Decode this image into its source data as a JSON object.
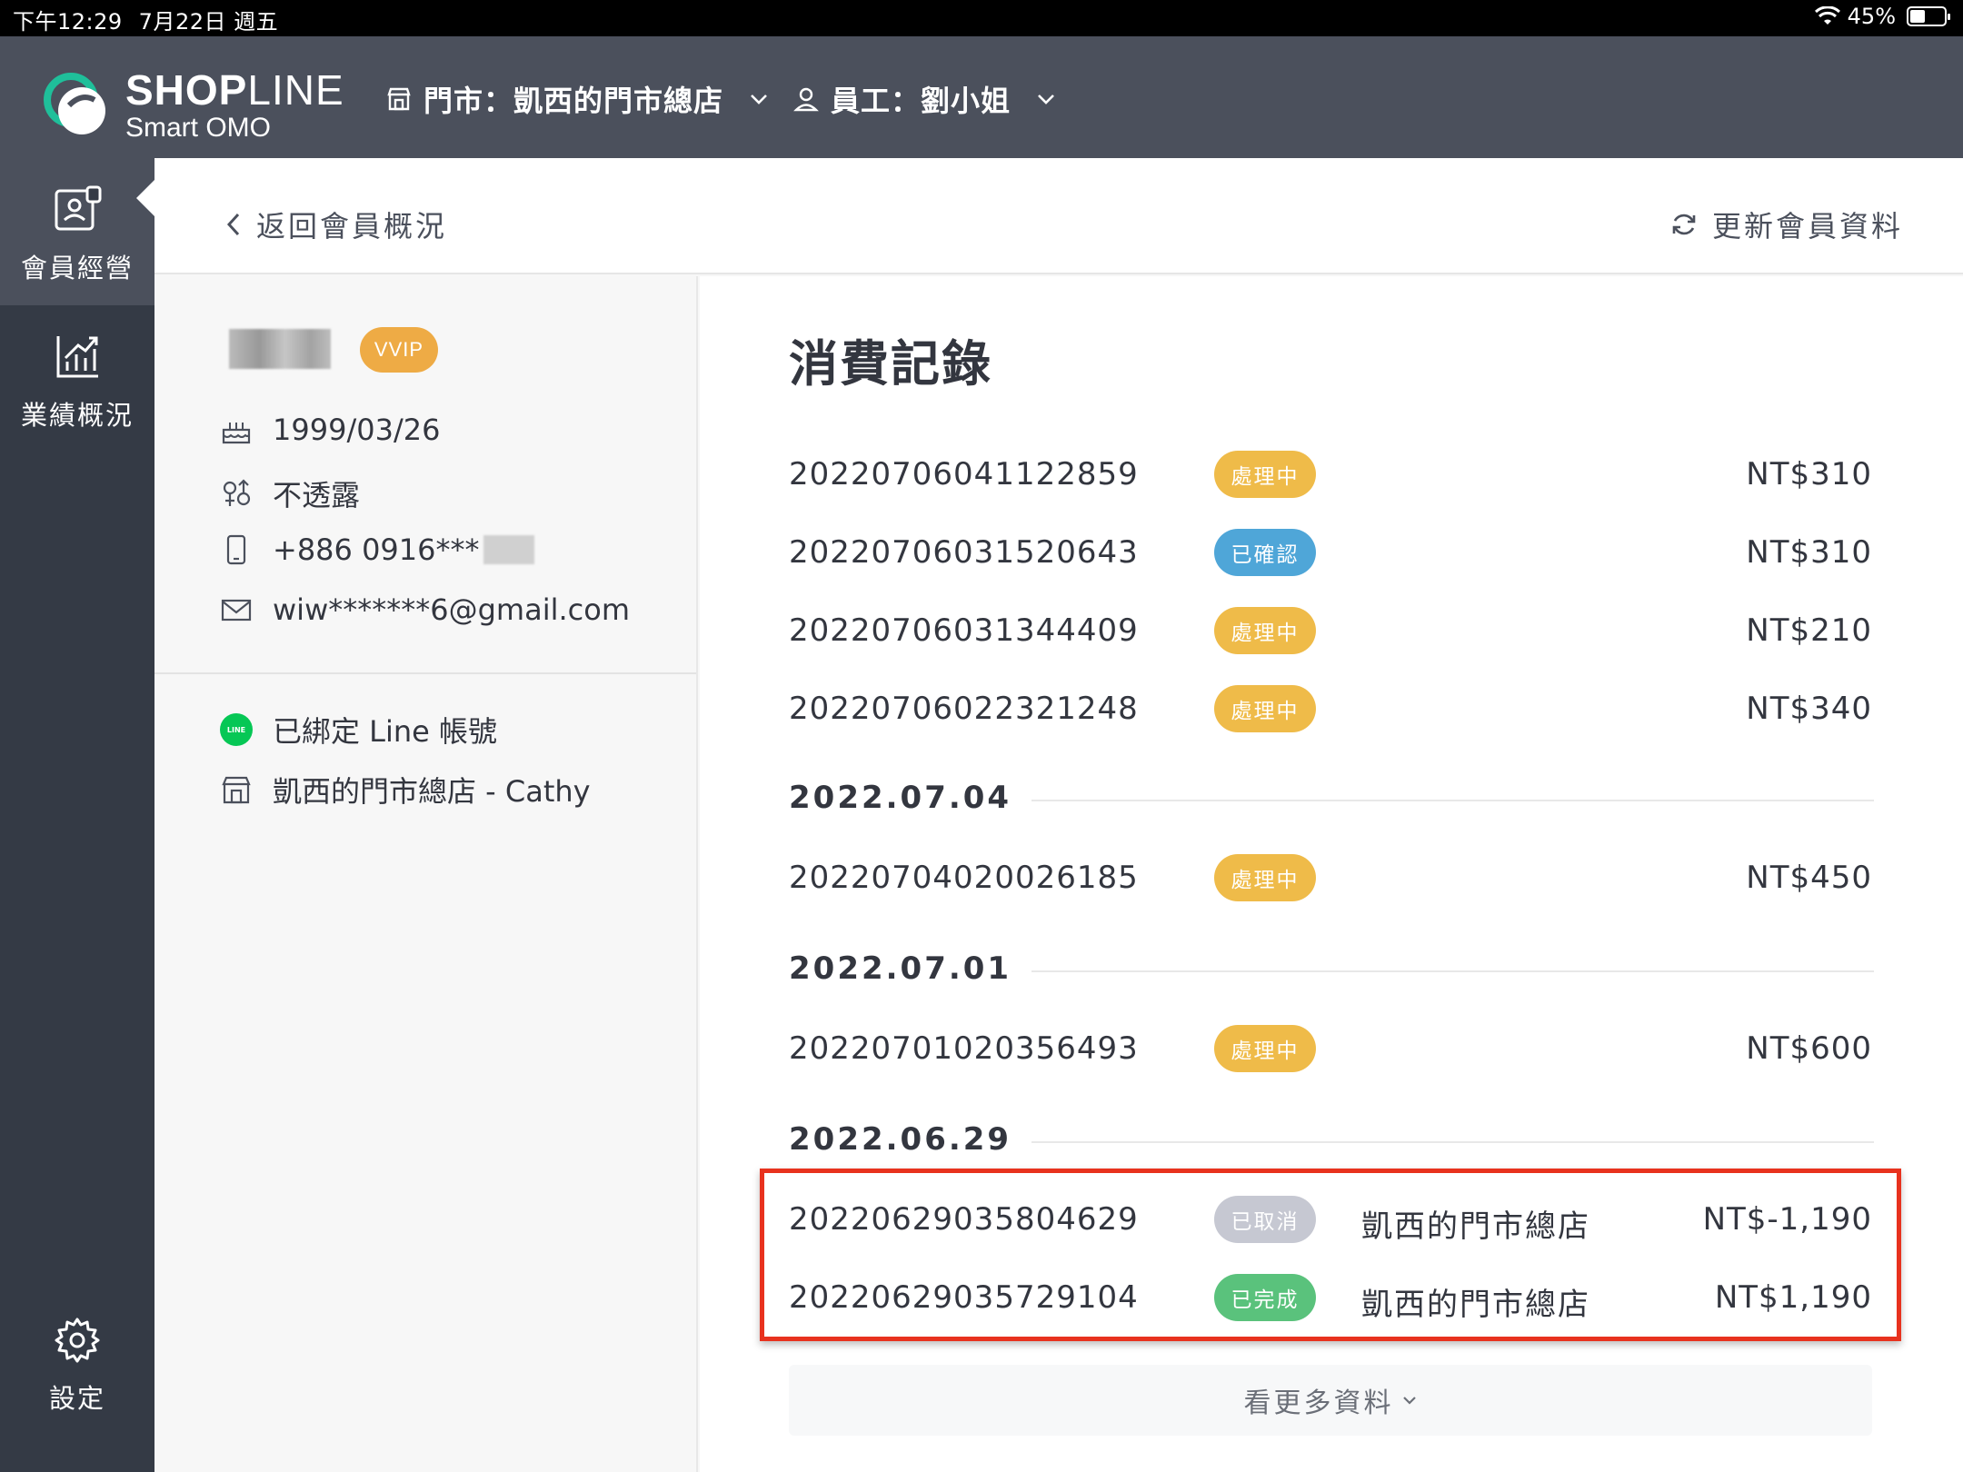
{
  "status_bar": {
    "time": "下午12:29",
    "date": "7月22日 週五",
    "battery_pct": "45%",
    "battery_level": 0.45
  },
  "brand": {
    "name_bold": "SHOP",
    "name_thin": "LINE",
    "sub": "Smart OMO",
    "accent": "#1fbf9a"
  },
  "header": {
    "store_selector": "門市：凱西的門市總店",
    "staff_selector": "員工：劉小姐"
  },
  "sidebar": {
    "items": [
      {
        "label": "會員經營",
        "icon": "member-card-icon",
        "active": true
      },
      {
        "label": "業績概況",
        "icon": "chart-icon",
        "active": false
      },
      {
        "label": "設定",
        "icon": "gear-icon",
        "active": false
      }
    ]
  },
  "topbar": {
    "back_label": "返回會員概況",
    "refresh_label": "更新會員資料"
  },
  "profile": {
    "tier": "VVIP",
    "birthday": "1999/03/26",
    "gender": "不透露",
    "phone": "+886 0916***",
    "email": "wiw*******6@gmail.com",
    "line_status": "已綁定 Line 帳號",
    "line_badge": "LINE",
    "store_staff": "凱西的門市總店 - Cathy"
  },
  "records": {
    "title": "消費記錄",
    "groups": [
      {
        "date": "",
        "orders": [
          {
            "id": "20220706041122859",
            "status": "處理中",
            "store": "",
            "amount": "NT$310"
          },
          {
            "id": "20220706031520643",
            "status": "已確認",
            "store": "",
            "amount": "NT$310"
          },
          {
            "id": "20220706031344409",
            "status": "處理中",
            "store": "",
            "amount": "NT$210"
          },
          {
            "id": "20220706022321248",
            "status": "處理中",
            "store": "",
            "amount": "NT$340"
          }
        ]
      },
      {
        "date": "2022.07.04",
        "orders": [
          {
            "id": "20220704020026185",
            "status": "處理中",
            "store": "",
            "amount": "NT$450"
          }
        ]
      },
      {
        "date": "2022.07.01",
        "orders": [
          {
            "id": "20220701020356493",
            "status": "處理中",
            "store": "",
            "amount": "NT$600"
          }
        ]
      },
      {
        "date": "2022.06.29",
        "orders": [
          {
            "id": "20220629035804629",
            "status": "已取消",
            "store": "凱西的門市總店",
            "amount": "NT$-1,190"
          },
          {
            "id": "20220629035729104",
            "status": "已完成",
            "store": "凱西的門市總店",
            "amount": "NT$1,190"
          }
        ]
      }
    ],
    "load_more": "看更多資料"
  },
  "status_colors": {
    "處理中": "#efbb49",
    "已確認": "#4fa6d8",
    "已取消": "#c6c8d2",
    "已完成": "#5ac27c"
  },
  "highlight_color": "#e8321e"
}
